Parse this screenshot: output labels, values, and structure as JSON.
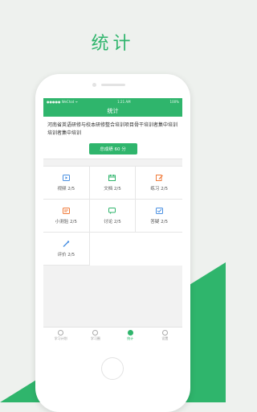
{
  "headline": "统计",
  "colors": {
    "brand": "#2fb56c",
    "background": "#eef1ee"
  },
  "status_bar": {
    "carrier": "●●●●● WeChat ᯤ",
    "time": "1:21 AM",
    "battery": "100%"
  },
  "app_header": {
    "title": "统计"
  },
  "project": {
    "title": "河南省英语研修与校本研修整合培训项目骨干培训者集中培训培训者集中培训",
    "score_label": "总成绩 60 分"
  },
  "stats": [
    {
      "label": "视频 2/5",
      "icon": "video-icon",
      "color": "#4a90e2"
    },
    {
      "label": "文档 2/5",
      "icon": "calendar-icon",
      "color": "#2fb56c"
    },
    {
      "label": "练习 2/5",
      "icon": "edit-icon",
      "color": "#f07b3a"
    },
    {
      "label": "小测验 2/5",
      "icon": "quiz-icon",
      "color": "#f07b3a"
    },
    {
      "label": "讨论 2/5",
      "icon": "discussion-icon",
      "color": "#2fb56c"
    },
    {
      "label": "答疑 2/5",
      "icon": "qa-icon",
      "color": "#4a90e2"
    },
    {
      "label": "评价 2/5",
      "icon": "review-icon",
      "color": "#4a90e2"
    }
  ],
  "tabs": [
    {
      "label": "学习计划",
      "icon": "plan-icon"
    },
    {
      "label": "学习圈",
      "icon": "circle-icon"
    },
    {
      "label": "统计",
      "icon": "stats-icon"
    },
    {
      "label": "设置",
      "icon": "settings-icon"
    }
  ]
}
